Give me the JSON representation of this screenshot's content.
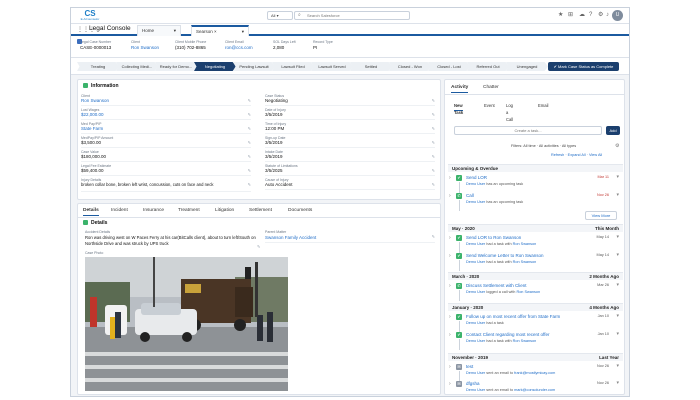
{
  "topbar": {
    "logo_mark": "CS",
    "logo_text": "E-ACounselor",
    "search_scope": "All",
    "search_placeholder": "Search Salesforce"
  },
  "nav": {
    "app_name": "Legal Console",
    "tabs": [
      {
        "label": "Home"
      },
      {
        "label": "Searson ×"
      }
    ]
  },
  "record": {
    "fields": [
      {
        "label": "Legal Case Number",
        "value": "CASE-0000013"
      },
      {
        "label": "Client",
        "value": "Ron Swanson"
      },
      {
        "label": "Client Mobile Phone",
        "value": "(310) 702-8865"
      },
      {
        "label": "Client Email",
        "value": "ron@ccs.com"
      },
      {
        "label": "SOL Days Left",
        "value": "2,080"
      },
      {
        "label": "Record Type",
        "value": "PI"
      }
    ]
  },
  "path": {
    "steps": [
      "Treating",
      "Collecting Medi...",
      "Ready for Demo...",
      "Negotiating",
      "Pending Lawsuit",
      "Lawsuit Filed",
      "Lawsuit Served",
      "Settled",
      "Closed - Won",
      "Closed - Lost",
      "Referred Out",
      "Unengaged"
    ],
    "current_index": 3,
    "mark_label": "✔ Mark Case Status as Complete"
  },
  "information": {
    "title": "Information",
    "left": [
      {
        "label": "Client",
        "value": "Ron Swanson"
      },
      {
        "label": "Lost Wages",
        "value": "$22,000.00"
      },
      {
        "label": "Med Pay/PIP",
        "value": "State Farm"
      },
      {
        "label": "MedPay/PIP Amount",
        "value": "$3,500.00"
      },
      {
        "label": "Case Value",
        "value": "$180,000.00"
      },
      {
        "label": "Legal Fee Estimate",
        "value": "$59,400.00"
      },
      {
        "label": "Injury Details",
        "value": "broken collar bone, broken left wrist, concussion, cuts on face and neck"
      }
    ],
    "right": [
      {
        "label": "Case Status",
        "value": "Negotiating"
      },
      {
        "label": "Date of Injury",
        "value": "3/5/2019"
      },
      {
        "label": "Time of Injury",
        "value": "12:00 PM"
      },
      {
        "label": "Sign-up Date",
        "value": "3/5/2019"
      },
      {
        "label": "Intake Date",
        "value": "3/5/2019"
      },
      {
        "label": "Statute of Limitations",
        "value": "3/5/2025"
      },
      {
        "label": "Cause of Injury",
        "value": "Auto Accident"
      }
    ]
  },
  "details_tabs": [
    "Details",
    "Incident",
    "Insurance",
    "Treatment",
    "Litigation",
    "Settlement",
    "Documents"
  ],
  "details": {
    "title": "Details",
    "accident_label": "Accident Details",
    "accident_text": "Ron was driving west on W Paces Ferry at his car(BitCalls client), about to turn left/South on Northside Drive and was struck by UPS truck",
    "photo_label": "Case Photo",
    "parent_label": "Parent Matter",
    "parent_value": "Swanson Family Accident"
  },
  "activity": {
    "tabs": [
      "Activity",
      "Chatter"
    ],
    "subtabs": [
      "New Task",
      "Event",
      "Log a Call",
      "Email"
    ],
    "task_placeholder": "Create a task...",
    "add_label": "Add",
    "filters": "Filters: All time · All activities · All types",
    "links": "Refresh · Expand All · View All",
    "view_more": "View More",
    "sections": [
      {
        "label": "Upcoming & Overdue",
        "right": ""
      },
      {
        "label": "May · 2020",
        "right": "This Month"
      },
      {
        "label": "March · 2020",
        "right": "2 Months Ago"
      },
      {
        "label": "January · 2020",
        "right": "4 Months Ago"
      },
      {
        "label": "November · 2019",
        "right": "Last Year"
      }
    ],
    "items": [
      {
        "title": "Send LOR",
        "sub_pre": "Demo User",
        "sub_post": " has an upcoming task",
        "sub_link": "",
        "date": "Mar 11"
      },
      {
        "title": "Call",
        "sub_pre": "Demo User",
        "sub_post": " has an upcoming task",
        "sub_link": "",
        "date": "Nov 26"
      },
      {
        "title": "Send LOR to Ron Swanson",
        "sub_pre": "Demo User",
        "sub_post": " had a task with ",
        "sub_link": "Ron Swanson",
        "date": "May 14"
      },
      {
        "title": "Send Welcome Letter to Ron Swanson",
        "sub_pre": "Demo User",
        "sub_post": " had a task with ",
        "sub_link": "Ron Swanson",
        "date": "May 14"
      },
      {
        "title": "Discuss Settlement with Client",
        "sub_pre": "Demo User",
        "sub_post": " logged a call with ",
        "sub_link": "Ron Swanson",
        "date": "Mar 26"
      },
      {
        "title": "Follow up on most recent offer from State Farm",
        "sub_pre": "Demo User",
        "sub_post": " had a task",
        "sub_link": "",
        "date": "Jan 10"
      },
      {
        "title": "Contact Client regarding most recent offer",
        "sub_pre": "Demo User",
        "sub_post": " had a task with ",
        "sub_link": "Ron Swanson",
        "date": "Jan 10"
      },
      {
        "title": "test",
        "sub_pre": "Demo User",
        "sub_post": " sent an email to ",
        "sub_link": "frank@mostlymicay.com",
        "date": "Nov 26"
      },
      {
        "title": "dfgsha",
        "sub_pre": "Demo User",
        "sub_post": " sent an email to ",
        "sub_link": "mark@consolunder.com",
        "date": "Nov 26"
      }
    ]
  },
  "colors": {
    "brand": "#1b5aa0",
    "path_current": "#1b3f6e",
    "task_green": "#3bb36b",
    "overdue_red": "#c23934"
  }
}
